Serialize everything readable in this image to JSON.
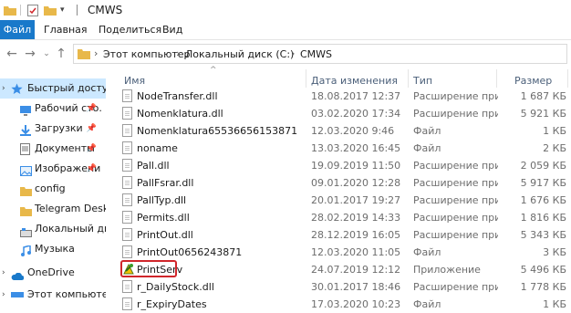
{
  "window": {
    "title": "CMWS"
  },
  "ribbon": {
    "tabs": [
      "Файл",
      "Главная",
      "Поделиться",
      "Вид"
    ]
  },
  "address": {
    "crumbs": [
      "Этот компьютер",
      "Локальный диск (C:)",
      "CMWS"
    ]
  },
  "sidebar": {
    "items": [
      {
        "label": "Быстрый доступ",
        "icon": "star-icon",
        "pinned": false,
        "selected": true
      },
      {
        "label": "Рабочий сто.",
        "icon": "desktop-icon",
        "pinned": true
      },
      {
        "label": "Загрузки",
        "icon": "download-icon",
        "pinned": true
      },
      {
        "label": "Документы",
        "icon": "documents-icon",
        "pinned": true
      },
      {
        "label": "Изображени",
        "icon": "pictures-icon",
        "pinned": true
      },
      {
        "label": "config",
        "icon": "folder-icon",
        "pinned": false
      },
      {
        "label": "Telegram Deskto",
        "icon": "folder-icon",
        "pinned": false
      },
      {
        "label": "Локальный дис",
        "icon": "drive-icon",
        "pinned": false
      },
      {
        "label": "Музыка",
        "icon": "music-icon",
        "pinned": false
      },
      {
        "label": "OneDrive",
        "icon": "cloud-icon",
        "pinned": false
      },
      {
        "label": "Этот компьютер",
        "icon": "computer-icon",
        "pinned": false
      }
    ]
  },
  "columns": {
    "name": "Имя",
    "date": "Дата изменения",
    "type": "Тип",
    "size": "Размер"
  },
  "files": [
    {
      "name": "NodeTransfer.dll",
      "date": "18.08.2017 12:37",
      "type": "Расширение при...",
      "size": "1 687 КБ",
      "icon": "dll-file-icon"
    },
    {
      "name": "Nomenklatura.dll",
      "date": "03.02.2020 17:34",
      "type": "Расширение при...",
      "size": "5 921 КБ",
      "icon": "dll-file-icon"
    },
    {
      "name": "Nomenklatura65536656153871",
      "date": "12.03.2020 9:46",
      "type": "Файл",
      "size": "1 КБ",
      "icon": "file-icon"
    },
    {
      "name": "noname",
      "date": "13.03.2020 16:45",
      "type": "Файл",
      "size": "2 КБ",
      "icon": "file-icon"
    },
    {
      "name": "Pall.dll",
      "date": "19.09.2019 11:50",
      "type": "Расширение при...",
      "size": "2 059 КБ",
      "icon": "dll-file-icon"
    },
    {
      "name": "PallFsrar.dll",
      "date": "09.01.2020 12:28",
      "type": "Расширение при...",
      "size": "5 917 КБ",
      "icon": "dll-file-icon"
    },
    {
      "name": "PallTyp.dll",
      "date": "20.01.2017 19:27",
      "type": "Расширение при...",
      "size": "1 676 КБ",
      "icon": "dll-file-icon"
    },
    {
      "name": "Permits.dll",
      "date": "28.02.2019 14:33",
      "type": "Расширение при...",
      "size": "1 816 КБ",
      "icon": "dll-file-icon"
    },
    {
      "name": "PrintOut.dll",
      "date": "28.12.2019 16:05",
      "type": "Расширение при...",
      "size": "5 343 КБ",
      "icon": "dll-file-icon"
    },
    {
      "name": "PrintOut0656243871",
      "date": "12.03.2020 11:05",
      "type": "Файл",
      "size": "3 КБ",
      "icon": "file-icon"
    },
    {
      "name": "PrintServ",
      "date": "24.07.2019 12:12",
      "type": "Приложение",
      "size": "5 496 КБ",
      "icon": "application-icon",
      "highlighted": true
    },
    {
      "name": "r_DailyStock.dll",
      "date": "30.01.2017 18:46",
      "type": "Расширение при...",
      "size": "1 778 КБ",
      "icon": "dll-file-icon"
    },
    {
      "name": "r_ExpiryDates",
      "date": "17.03.2020 10:23",
      "type": "Файл",
      "size": "1 КБ",
      "icon": "file-icon"
    }
  ],
  "colors": {
    "accent": "#1979ca",
    "selection": "#cce8ff",
    "highlight_border": "#d0262b"
  }
}
